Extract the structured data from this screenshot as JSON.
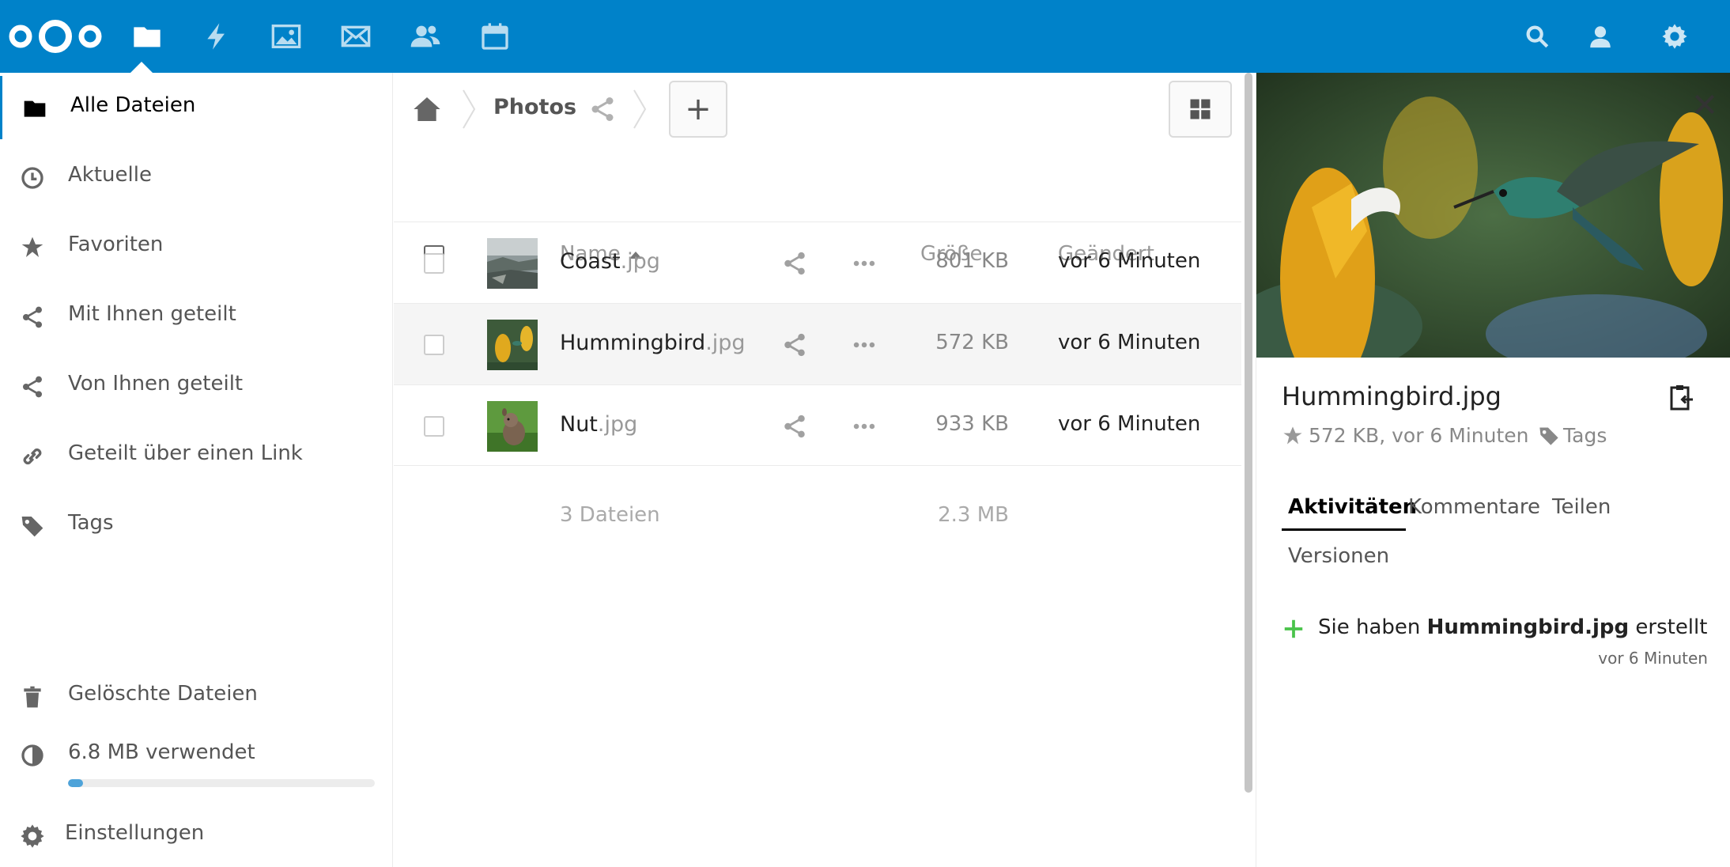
{
  "header": {
    "apps": [
      {
        "name": "files-app",
        "icon": "folder-icon",
        "active": true
      },
      {
        "name": "activity-app",
        "icon": "lightning-icon",
        "active": false
      },
      {
        "name": "gallery-app",
        "icon": "image-icon",
        "active": false
      },
      {
        "name": "mail-app",
        "icon": "mail-icon",
        "active": false
      },
      {
        "name": "contacts-app",
        "icon": "contacts-icon",
        "active": false
      },
      {
        "name": "calendar-app",
        "icon": "calendar-icon",
        "active": false
      }
    ],
    "right_icons": [
      "search-icon",
      "user-icon",
      "gear-icon"
    ],
    "color": "#0082c9"
  },
  "sidebar": {
    "items": [
      {
        "label": "Alle Dateien",
        "icon": "folder-icon",
        "active": true
      },
      {
        "label": "Aktuelle",
        "icon": "clock-icon"
      },
      {
        "label": "Favoriten",
        "icon": "star-icon"
      },
      {
        "label": "Mit Ihnen geteilt",
        "icon": "share-icon"
      },
      {
        "label": "Von Ihnen geteilt",
        "icon": "share-icon"
      },
      {
        "label": "Geteilt über einen Link",
        "icon": "link-icon"
      },
      {
        "label": "Tags",
        "icon": "tag-icon"
      }
    ],
    "bottom": {
      "deleted": "Gelöschte Dateien",
      "quota": "6.8 MB verwendet",
      "quota_fraction": 0.05,
      "settings": "Einstellungen"
    }
  },
  "breadcrumb": {
    "folder": "Photos",
    "add_label": "+"
  },
  "table": {
    "headers": {
      "name": "Name",
      "size": "Größe",
      "modified": "Geändert"
    },
    "rows": [
      {
        "base": "Coast",
        "ext": ".jpg",
        "size": "801 KB",
        "modified": "vor 6 Minuten"
      },
      {
        "base": "Hummingbird",
        "ext": ".jpg",
        "size": "572 KB",
        "modified": "vor 6 Minuten",
        "selected": true
      },
      {
        "base": "Nut",
        "ext": ".jpg",
        "size": "933 KB",
        "modified": "vor 6 Minuten"
      }
    ],
    "summary": {
      "count": "3 Dateien",
      "total": "2.3 MB"
    }
  },
  "details": {
    "title": "Hummingbird.jpg",
    "meta": "572 KB, vor 6 Minuten",
    "tags": "Tags",
    "tabs": [
      "Aktivitäten",
      "Kommentare",
      "Teilen",
      "Versionen"
    ],
    "activity": {
      "prefix": "Sie haben ",
      "file": "Hummingbird.jpg",
      "suffix": " erstellt",
      "time": "vor 6 Minuten"
    }
  }
}
